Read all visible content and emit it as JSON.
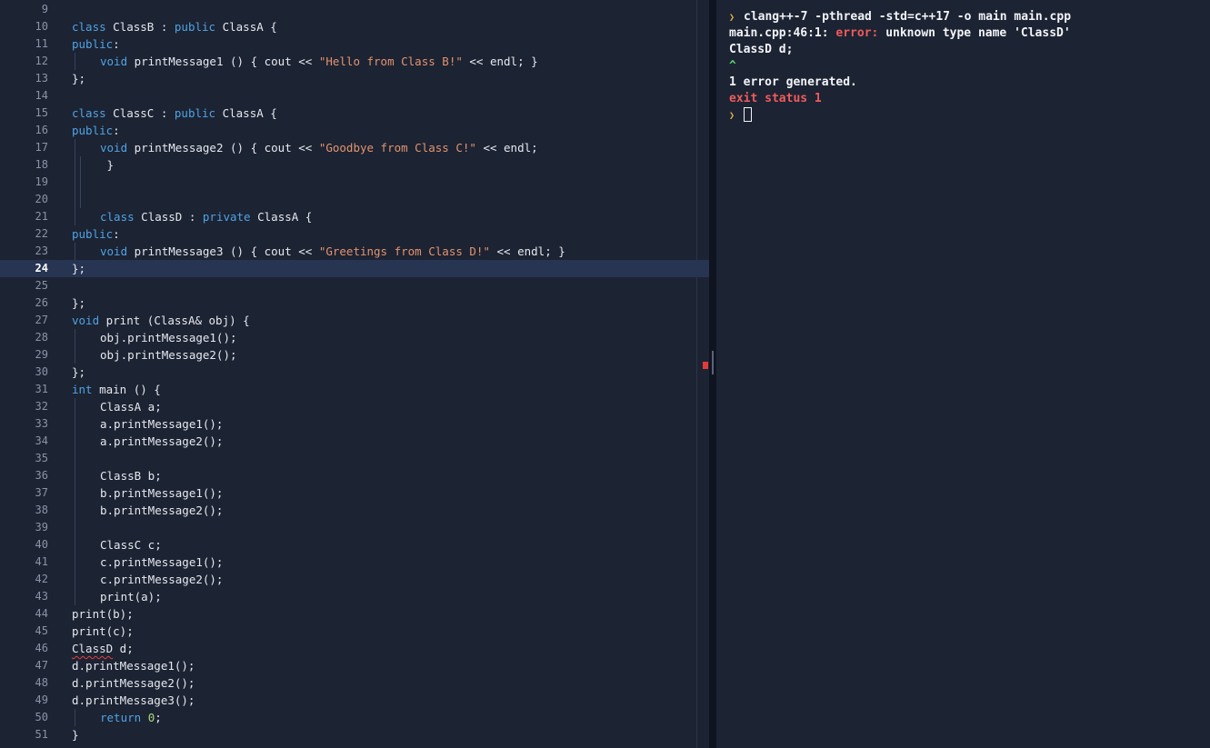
{
  "colors": {
    "background": "#1c2333",
    "active_line": "#273452",
    "keyword": "#4fa3e3",
    "string": "#e3946e",
    "number": "#a8d97a",
    "error": "#f05b5b",
    "prompt": "#e3b341"
  },
  "editor": {
    "active_line_number": "24",
    "lines": [
      {
        "n": "9",
        "indent": 0,
        "guides": 0,
        "tokens": []
      },
      {
        "n": "10",
        "indent": 0,
        "guides": 0,
        "tokens": [
          [
            "kw",
            "class"
          ],
          [
            "t",
            " ClassB : "
          ],
          [
            "kw",
            "public"
          ],
          [
            "t",
            " ClassA {"
          ]
        ]
      },
      {
        "n": "11",
        "indent": 0,
        "guides": 0,
        "tokens": [
          [
            "kw",
            "public"
          ],
          [
            "t",
            ":"
          ]
        ]
      },
      {
        "n": "12",
        "indent": 1,
        "guides": 1,
        "tokens": [
          [
            "kw",
            "void"
          ],
          [
            "t",
            " printMessage1 () { cout << "
          ],
          [
            "str",
            "\"Hello from Class B!\""
          ],
          [
            "t",
            " << endl; }"
          ]
        ]
      },
      {
        "n": "13",
        "indent": 0,
        "guides": 0,
        "tokens": [
          [
            "t",
            "};"
          ]
        ]
      },
      {
        "n": "14",
        "indent": 0,
        "guides": 0,
        "tokens": []
      },
      {
        "n": "15",
        "indent": 0,
        "guides": 0,
        "tokens": [
          [
            "kw",
            "class"
          ],
          [
            "t",
            " ClassC : "
          ],
          [
            "kw",
            "public"
          ],
          [
            "t",
            " ClassA {"
          ]
        ]
      },
      {
        "n": "16",
        "indent": 0,
        "guides": 0,
        "tokens": [
          [
            "kw",
            "public"
          ],
          [
            "t",
            ":"
          ]
        ]
      },
      {
        "n": "17",
        "indent": 1,
        "guides": 1,
        "tokens": [
          [
            "kw",
            "void"
          ],
          [
            "t",
            " printMessage2 () { cout << "
          ],
          [
            "str",
            "\"Goodbye from Class C!\""
          ],
          [
            "t",
            " << endl;"
          ]
        ]
      },
      {
        "n": "18",
        "indent": 1,
        "guides": 2,
        "tokens": [
          [
            "t",
            " }"
          ]
        ]
      },
      {
        "n": "19",
        "indent": 0,
        "guides": 2,
        "tokens": []
      },
      {
        "n": "20",
        "indent": 0,
        "guides": 2,
        "tokens": []
      },
      {
        "n": "21",
        "indent": 1,
        "guides": 1,
        "tokens": [
          [
            "kw",
            "class"
          ],
          [
            "t",
            " ClassD : "
          ],
          [
            "kw",
            "private"
          ],
          [
            "t",
            " ClassA {"
          ]
        ]
      },
      {
        "n": "22",
        "indent": 0,
        "guides": 0,
        "tokens": [
          [
            "kw",
            "public"
          ],
          [
            "t",
            ":"
          ]
        ]
      },
      {
        "n": "23",
        "indent": 1,
        "guides": 1,
        "tokens": [
          [
            "kw",
            "void"
          ],
          [
            "t",
            " printMessage3 () { cout << "
          ],
          [
            "str",
            "\"Greetings from Class D!\""
          ],
          [
            "t",
            " << endl; }"
          ]
        ]
      },
      {
        "n": "24",
        "indent": 0,
        "guides": 0,
        "active": true,
        "tokens": [
          [
            "t",
            "};"
          ]
        ]
      },
      {
        "n": "25",
        "indent": 0,
        "guides": 0,
        "tokens": []
      },
      {
        "n": "26",
        "indent": 0,
        "guides": 0,
        "tokens": [
          [
            "t",
            "};"
          ]
        ]
      },
      {
        "n": "27",
        "indent": 0,
        "guides": 0,
        "tokens": [
          [
            "kw",
            "void"
          ],
          [
            "t",
            " print (ClassA& obj) {"
          ]
        ]
      },
      {
        "n": "28",
        "indent": 1,
        "guides": 1,
        "tokens": [
          [
            "t",
            "obj.printMessage1();"
          ]
        ]
      },
      {
        "n": "29",
        "indent": 1,
        "guides": 1,
        "tokens": [
          [
            "t",
            "obj.printMessage2();"
          ]
        ]
      },
      {
        "n": "30",
        "indent": 0,
        "guides": 0,
        "tokens": [
          [
            "t",
            "};"
          ]
        ]
      },
      {
        "n": "31",
        "indent": 0,
        "guides": 0,
        "tokens": [
          [
            "kw",
            "int"
          ],
          [
            "t",
            " main () {"
          ]
        ]
      },
      {
        "n": "32",
        "indent": 1,
        "guides": 1,
        "tokens": [
          [
            "t",
            "ClassA a;"
          ]
        ]
      },
      {
        "n": "33",
        "indent": 1,
        "guides": 1,
        "tokens": [
          [
            "t",
            "a.printMessage1();"
          ]
        ]
      },
      {
        "n": "34",
        "indent": 1,
        "guides": 1,
        "tokens": [
          [
            "t",
            "a.printMessage2();"
          ]
        ]
      },
      {
        "n": "35",
        "indent": 0,
        "guides": 1,
        "tokens": []
      },
      {
        "n": "36",
        "indent": 1,
        "guides": 1,
        "tokens": [
          [
            "t",
            "ClassB b;"
          ]
        ]
      },
      {
        "n": "37",
        "indent": 1,
        "guides": 1,
        "tokens": [
          [
            "t",
            "b.printMessage1();"
          ]
        ]
      },
      {
        "n": "38",
        "indent": 1,
        "guides": 1,
        "tokens": [
          [
            "t",
            "b.printMessage2();"
          ]
        ]
      },
      {
        "n": "39",
        "indent": 0,
        "guides": 1,
        "tokens": []
      },
      {
        "n": "40",
        "indent": 1,
        "guides": 1,
        "tokens": [
          [
            "t",
            "ClassC c;"
          ]
        ]
      },
      {
        "n": "41",
        "indent": 1,
        "guides": 1,
        "tokens": [
          [
            "t",
            "c.printMessage1();"
          ]
        ]
      },
      {
        "n": "42",
        "indent": 1,
        "guides": 1,
        "tokens": [
          [
            "t",
            "c.printMessage2();"
          ]
        ]
      },
      {
        "n": "43",
        "indent": 1,
        "guides": 1,
        "tokens": [
          [
            "t",
            "print(a);"
          ]
        ]
      },
      {
        "n": "44",
        "indent": 0,
        "guides": 0,
        "tokens": [
          [
            "t",
            "print(b);"
          ]
        ]
      },
      {
        "n": "45",
        "indent": 0,
        "guides": 0,
        "tokens": [
          [
            "t",
            "print(c);"
          ]
        ]
      },
      {
        "n": "46",
        "indent": 0,
        "guides": 0,
        "tokens": [
          [
            "err",
            "ClassD"
          ],
          [
            "t",
            " d;"
          ]
        ]
      },
      {
        "n": "47",
        "indent": 0,
        "guides": 0,
        "tokens": [
          [
            "t",
            "d.printMessage1();"
          ]
        ]
      },
      {
        "n": "48",
        "indent": 0,
        "guides": 0,
        "tokens": [
          [
            "t",
            "d.printMessage2();"
          ]
        ]
      },
      {
        "n": "49",
        "indent": 0,
        "guides": 0,
        "tokens": [
          [
            "t",
            "d.printMessage3();"
          ]
        ]
      },
      {
        "n": "50",
        "indent": 1,
        "guides": 1,
        "tokens": [
          [
            "kw",
            "return"
          ],
          [
            "t",
            " "
          ],
          [
            "num",
            "0"
          ],
          [
            "t",
            ";"
          ]
        ]
      },
      {
        "n": "51",
        "indent": 0,
        "guides": 0,
        "tokens": [
          [
            "t",
            "}"
          ]
        ]
      }
    ]
  },
  "console": {
    "command": "clang++-7 -pthread -std=c++17 -o main main.cpp",
    "error_location": "main.cpp:46:1: ",
    "error_label": "error:",
    "error_message": " unknown type name 'ClassD'",
    "source_line": "ClassD d;",
    "caret": "^",
    "summary": "1 error generated.",
    "exit_status": "exit status 1",
    "prompt_icon": "prompt-chevron-icon"
  }
}
